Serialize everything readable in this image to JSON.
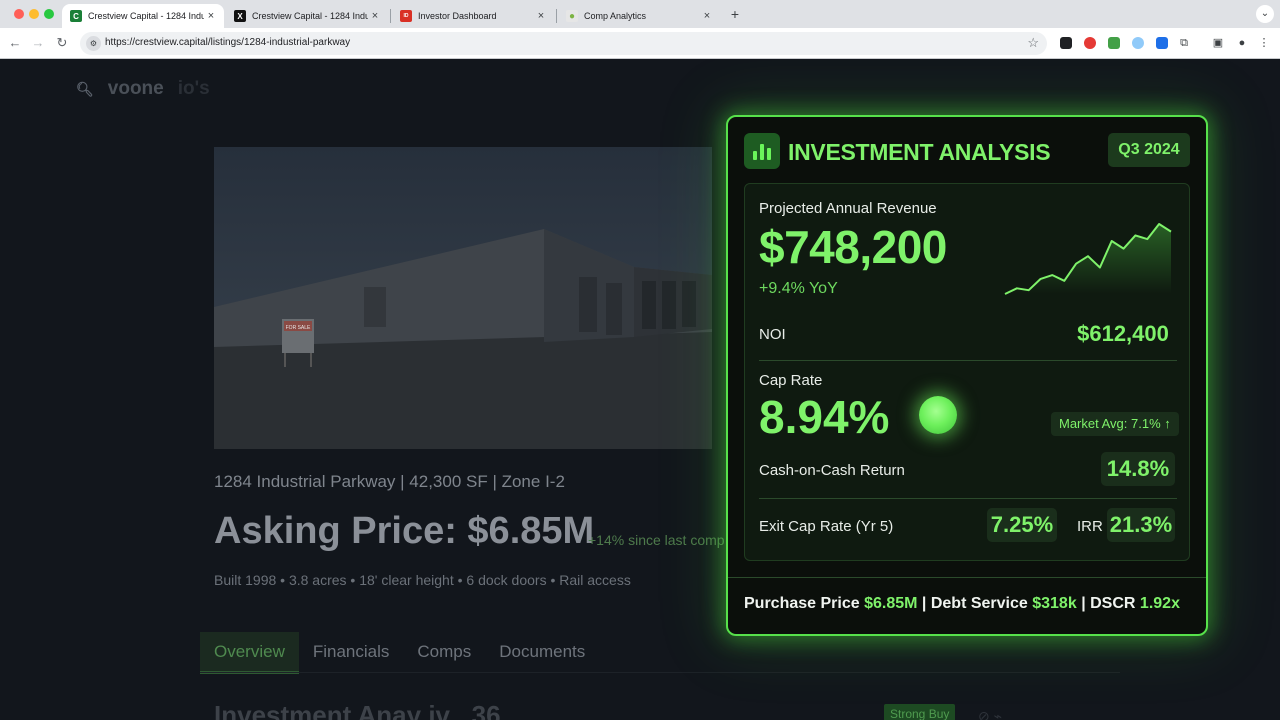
{
  "browser": {
    "tabs": [
      {
        "title": "Crestview Capital - 1284 Indu",
        "favicon": "crestview-logo",
        "favicon_color": "#1a7f37",
        "favicon_glyph": "C",
        "active": true
      },
      {
        "title": "Crestview Capital - 1284 Indu",
        "favicon": "x-logo",
        "favicon_color": "#111111",
        "favicon_glyph": "X",
        "active": false
      },
      {
        "title": "Investor Dashboard",
        "favicon": "dashboard-logo",
        "favicon_color": "#d93025",
        "favicon_glyph": "ID",
        "active": false
      },
      {
        "title": "Comp Analytics",
        "favicon": "comp-logo",
        "favicon_color": "#7cb342",
        "favicon_glyph": "●",
        "active": false
      }
    ],
    "new_tab_label": "+",
    "url": "https://crestview.capital/listings/1284-industrial-parkway",
    "close_glyph": "×"
  },
  "page": {
    "search_logo_text": "voone",
    "search_logo_ghost": "io's",
    "address_line": "1284 Industrial Parkway | 42,300 SF | Zone I-2",
    "asking_price": "Asking Price: $6.85M",
    "asking_change": "+14% since last comp",
    "specs": "Built 1998 • 3.8 acres • 18' clear height • 6 dock doors • Rail access",
    "photo_sign_text": "FOR SALE",
    "tabs": [
      {
        "label": "Overview",
        "active": true
      },
      {
        "label": "Financials",
        "active": false
      },
      {
        "label": "Comps",
        "active": false
      },
      {
        "label": "Documents",
        "active": false
      }
    ],
    "section_title": "Investment Anay iv . 36",
    "strong_buy": "Strong Buy"
  },
  "card": {
    "title": "INVESTMENT ANALYSIS",
    "quarter": "Q3 2024",
    "revenue_label": "Projected Annual Revenue",
    "revenue_value": "$748,200",
    "revenue_yoy": "+9.4% YoY",
    "revenue_trend": [
      12,
      18,
      16,
      28,
      32,
      26,
      44,
      52,
      40,
      68,
      60,
      74,
      70,
      86,
      78
    ],
    "noi_label": "NOI",
    "noi_value": "$612,400",
    "cap_rate_label": "Cap Rate",
    "cap_rate_value": "8.94%",
    "market_avg": "Market Avg: 7.1% ↑",
    "coc_label": "Cash-on-Cash Return",
    "coc_value": "14.8%",
    "exit_cap_label": "Exit Cap Rate (Yr 5)",
    "exit_cap_value": "7.25%",
    "irr_label": "IRR",
    "irr_value": "21.3%",
    "footer": {
      "purchase_label": "Purchase Price",
      "purchase_value": "$6.85M",
      "sep": "|",
      "debt_label": "Debt Service",
      "debt_value": "$318k",
      "dscr_label": "DSCR",
      "dscr_value": "1.92x"
    },
    "accent_color": "#7ff26a",
    "border_color": "#57e14b"
  }
}
